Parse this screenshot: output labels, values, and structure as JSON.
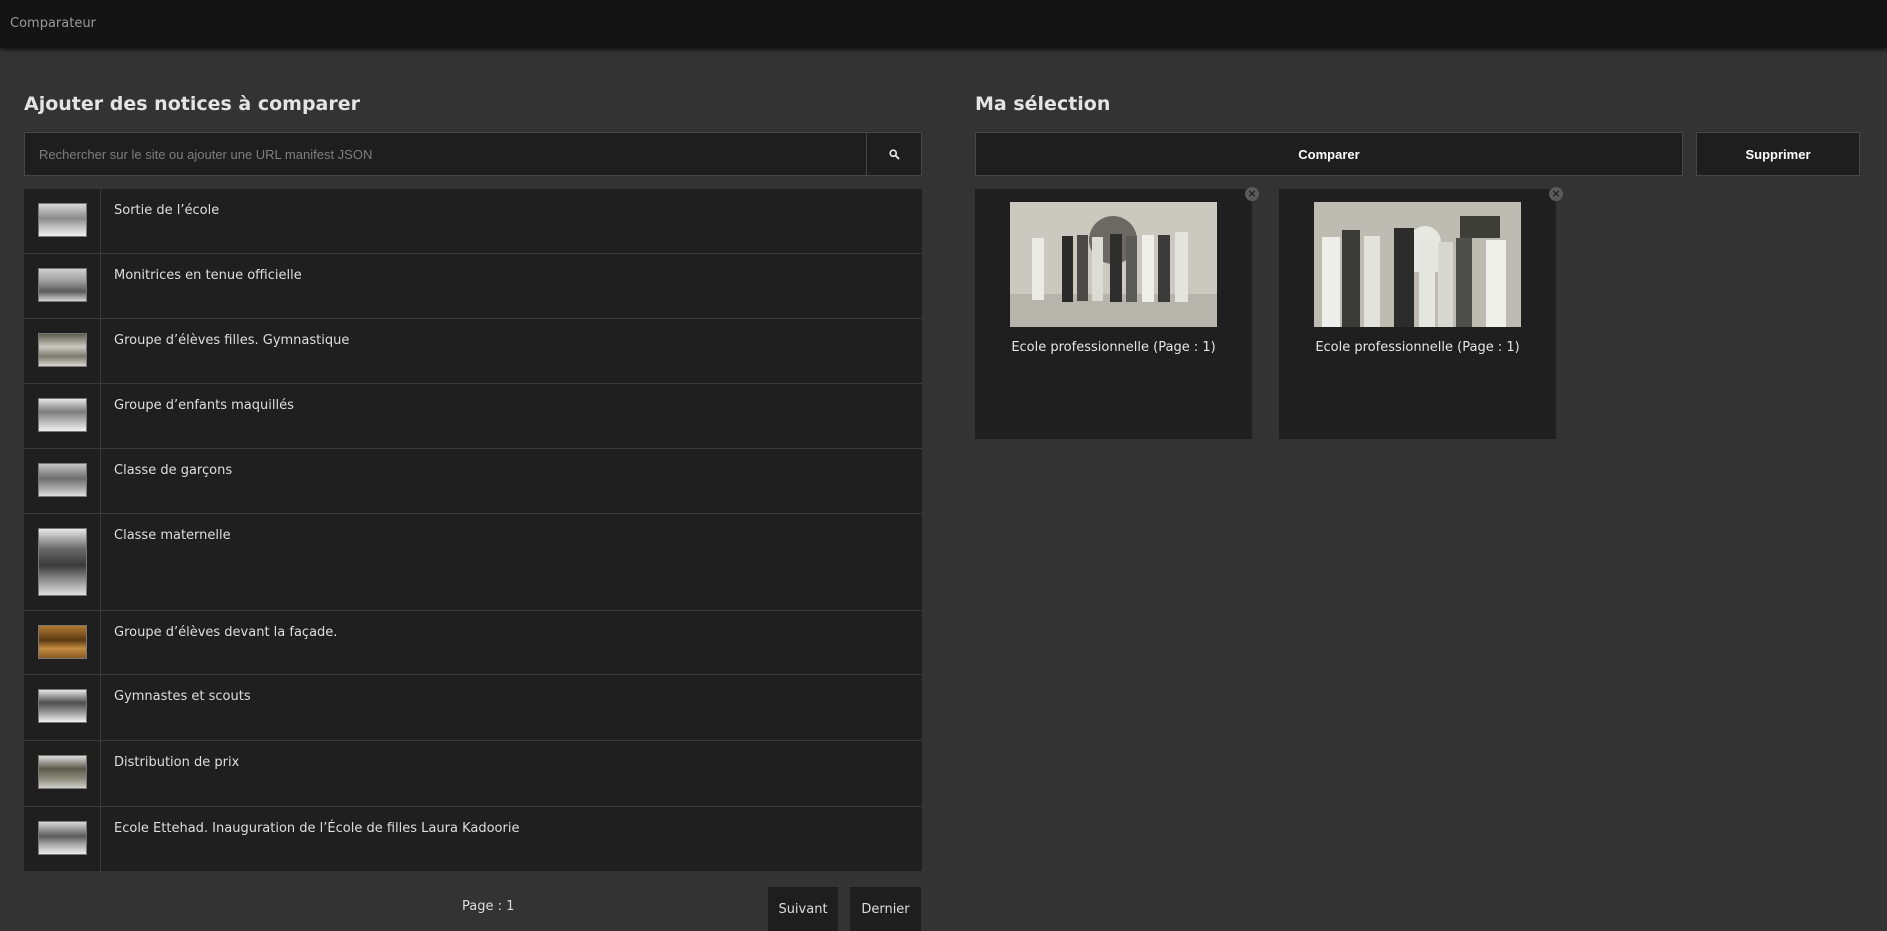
{
  "header": {
    "app_title": "Comparateur"
  },
  "left": {
    "title": "Ajouter des notices à comparer",
    "search": {
      "placeholder": "Rechercher sur le site ou ajouter une URL manifest JSON",
      "value": ""
    },
    "results": [
      {
        "label": "Sortie de l’école"
      },
      {
        "label": "Monitrices en tenue officielle"
      },
      {
        "label": "Groupe d’élèves filles. Gymnastique"
      },
      {
        "label": "Groupe d’enfants maquillés"
      },
      {
        "label": "Classe de garçons"
      },
      {
        "label": "Classe maternelle"
      },
      {
        "label": "Groupe d’élèves devant la façade."
      },
      {
        "label": "Gymnastes et scouts"
      },
      {
        "label": "Distribution de prix"
      },
      {
        "label": "Ecole Ettehad. Inauguration de l’École de filles Laura Kadoorie"
      }
    ],
    "pagination": {
      "page_label": "Page : 1",
      "next_label": "Suivant",
      "last_label": "Dernier"
    }
  },
  "right": {
    "title": "Ma sélection",
    "compare_label": "Comparer",
    "delete_label": "Supprimer",
    "selection": [
      {
        "caption": "Ecole professionnelle (Page : 1)"
      },
      {
        "caption": "Ecole professionnelle (Page : 1)"
      }
    ]
  },
  "colors": {
    "background": "#333333",
    "topbar": "#141414",
    "panel": "#1f1f1f",
    "border": "#474747"
  },
  "icons": {
    "search": "search-icon",
    "remove": "close-circle-icon"
  }
}
